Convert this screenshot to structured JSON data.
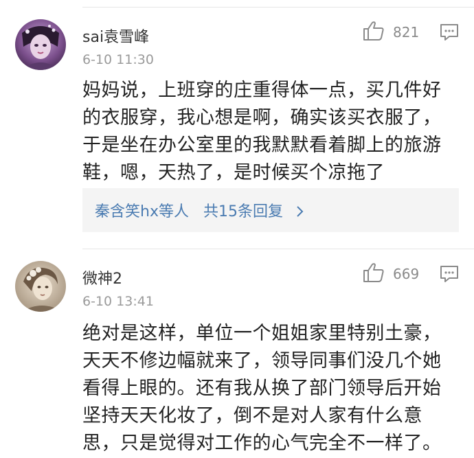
{
  "comments": [
    {
      "username": "sai袁雪峰",
      "time": "6-10 11:30",
      "likes": "821",
      "text": "妈妈说，上班穿的庄重得体一点，买几件好\n的衣服穿，我心想是啊，确实该买衣服了，\n于是坐在办公室里的我默默看着脚上的旅游\n鞋，嗯，天热了，是时候买个凉拖了",
      "replies": {
        "names": "秦含笑hx等人",
        "summary": "共15条回复"
      }
    },
    {
      "username": "微神2",
      "time": "6-10 13:41",
      "likes": "669",
      "text": "绝对是这样，单位一个姐姐家里特别土豪，\n天天不修边幅就来了，领导同事们没几个她\n看得上眼的。还有我从换了部门领导后开始\n坚持天天化妆了，倒不是对人家有什么意\n思，只是觉得对工作的心气完全不一样了。"
    }
  ],
  "icons": {
    "like": "thumbs-up-icon",
    "reply": "comment-bubble-icon",
    "chevron": "chevron-right-icon"
  },
  "colors": {
    "link": "#4a7bb1",
    "meta": "#9a9a9a",
    "reply_bg": "#f4f4f4"
  }
}
